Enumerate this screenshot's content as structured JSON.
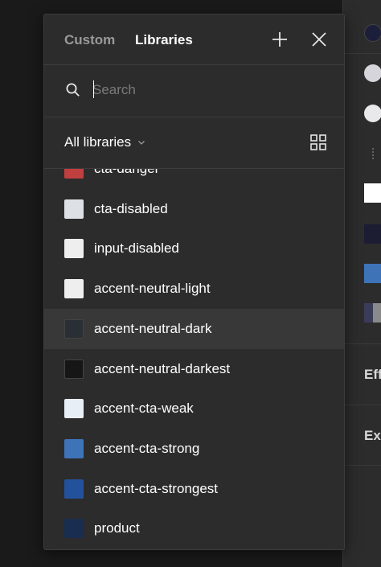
{
  "tabs": [
    {
      "label": "Custom",
      "active": false
    },
    {
      "label": "Libraries",
      "active": true
    }
  ],
  "header_icons": [
    "plus-icon",
    "close-icon"
  ],
  "search": {
    "placeholder": "Search",
    "value": ""
  },
  "library_filter": {
    "selected": "All libraries",
    "view_toggle_icon": "grid-view-icon"
  },
  "colors": {
    "panel_bg": "#2c2c2c",
    "hover_bg": "#383838",
    "text": "#ffffff",
    "muted_text": "#9a9a9a"
  },
  "styles": [
    {
      "name": "cta-danger",
      "color": "#c0403f",
      "partially_visible": true
    },
    {
      "name": "cta-disabled",
      "color": "#dde1e6"
    },
    {
      "name": "input-disabled",
      "color": "#eeeeee"
    },
    {
      "name": "accent-neutral-light",
      "color": "#eeeeee"
    },
    {
      "name": "accent-neutral-dark",
      "color": "#2a2f36",
      "hovered": true
    },
    {
      "name": "accent-neutral-darkest",
      "color": "#161616"
    },
    {
      "name": "accent-cta-weak",
      "color": "#e8eef6"
    },
    {
      "name": "accent-cta-strong",
      "color": "#3e73b8"
    },
    {
      "name": "accent-cta-strongest",
      "color": "#23519b"
    },
    {
      "name": "product",
      "color": "#182d4f"
    }
  ],
  "background_panel": {
    "section_labels": [
      "Effects",
      "Export"
    ],
    "swatch_colors": [
      "#1c1f3a",
      "#d6d5dc",
      "#e9e9ec",
      "#ffffff",
      "#1c1d33",
      "#3e73b8",
      "#3b3c5a"
    ]
  }
}
